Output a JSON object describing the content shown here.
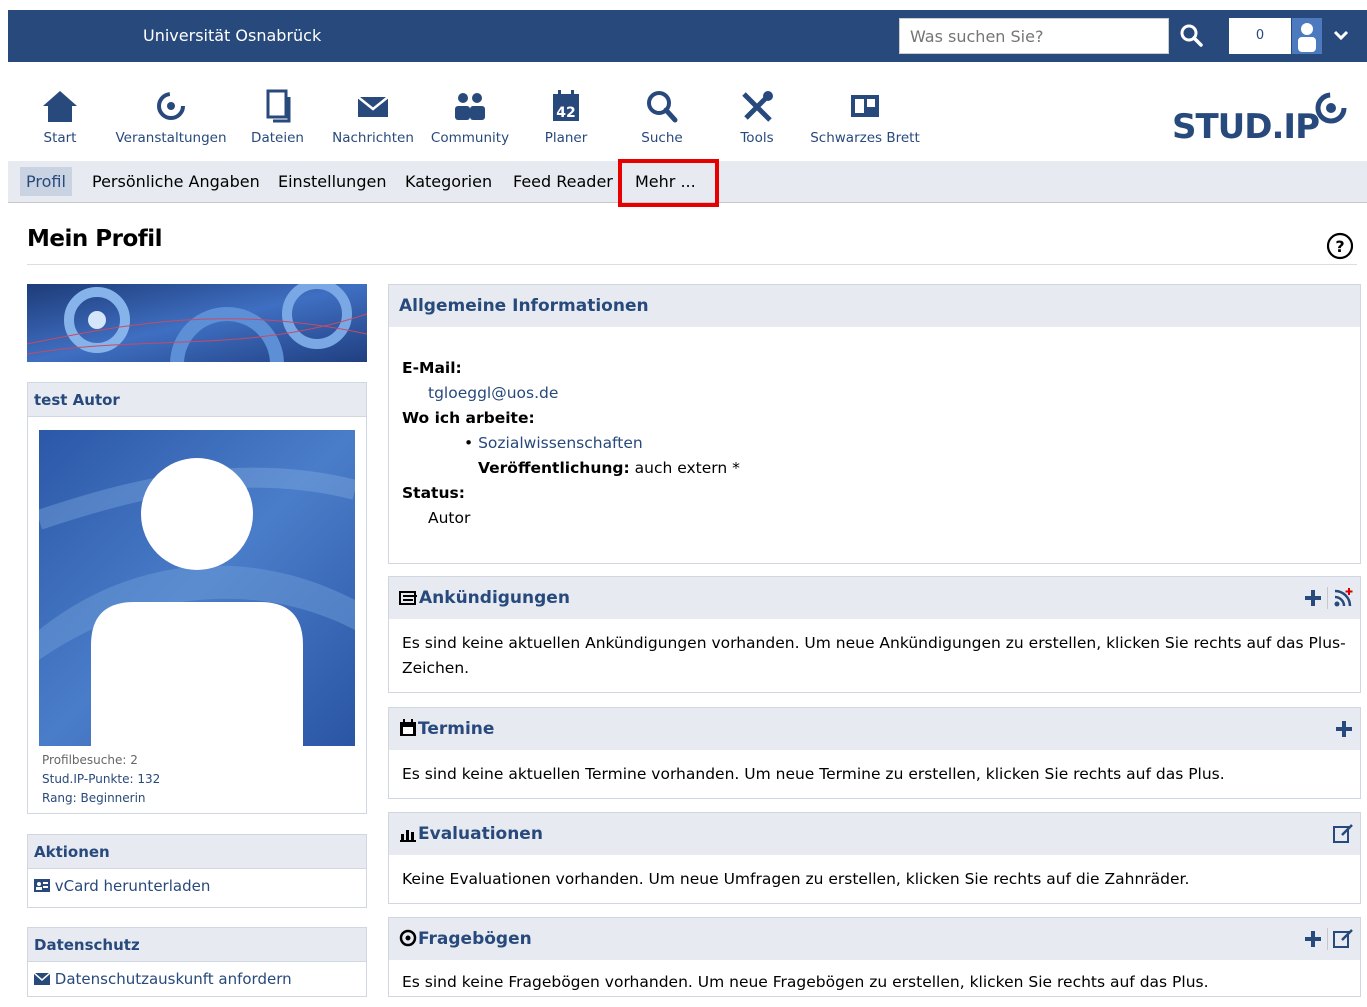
{
  "topbar": {
    "university": "Universität Osnabrück",
    "search_placeholder": "Was suchen Sie?",
    "notification_count": "0"
  },
  "mainnav": {
    "items": [
      {
        "label": "Start",
        "icon": "home-icon"
      },
      {
        "label": "Veranstaltungen",
        "icon": "courses-icon"
      },
      {
        "label": "Dateien",
        "icon": "files-icon"
      },
      {
        "label": "Nachrichten",
        "icon": "mail-icon"
      },
      {
        "label": "Community",
        "icon": "community-icon"
      },
      {
        "label": "Planer",
        "icon": "calendar-icon",
        "day": "42"
      },
      {
        "label": "Suche",
        "icon": "search-icon"
      },
      {
        "label": "Tools",
        "icon": "tools-icon"
      },
      {
        "label": "Schwarzes Brett",
        "icon": "board-icon"
      }
    ],
    "logo": "STUD.IP"
  },
  "subnav": {
    "items": [
      "Profil",
      "Persönliche Angaben",
      "Einstellungen",
      "Kategorien",
      "Feed Reader",
      "Mehr ..."
    ],
    "active": "Profil"
  },
  "page": {
    "title": "Mein Profil"
  },
  "user": {
    "name": "test Autor",
    "visits": "Profilbesuche: 2",
    "points": "Stud.IP-Punkte: 132",
    "rank": "Rang: Beginnerin"
  },
  "aktionen": {
    "title": "Aktionen",
    "vcard": "vCard herunterladen"
  },
  "datenschutz": {
    "title": "Datenschutz",
    "request": "Datenschutzauskunft anfordern"
  },
  "allgemein": {
    "title": "Allgemeine Informationen",
    "email_label": "E-Mail:",
    "email": "tgloeggl@uos.de",
    "work_label": "Wo ich arbeite:",
    "work": "Sozialwissenschaften",
    "publish_label": "Veröffentlichung:",
    "publish_value": "auch extern *",
    "status_label": "Status:",
    "status": "Autor"
  },
  "ankuendigungen": {
    "title": "Ankündigungen",
    "text": "Es sind keine aktuellen Ankündigungen vorhanden. Um neue Ankündigungen zu erstellen, klicken Sie rechts auf das Plus-Zeichen."
  },
  "termine": {
    "title": "Termine",
    "text": "Es sind keine aktuellen Termine vorhanden. Um neue Termine zu erstellen, klicken Sie rechts auf das Plus."
  },
  "evaluationen": {
    "title": "Evaluationen",
    "text": "Keine Evaluationen vorhanden. Um neue Umfragen zu erstellen, klicken Sie rechts auf die Zahnräder."
  },
  "frageboegen": {
    "title": "Fragebögen",
    "text": "Es sind keine Fragebögen vorhanden. Um neue Fragebögen zu erstellen, klicken Sie rechts auf das Plus."
  },
  "colors": {
    "brand": "#28497c",
    "header_bg": "#e7ebf1",
    "highlight": "#e60000"
  }
}
